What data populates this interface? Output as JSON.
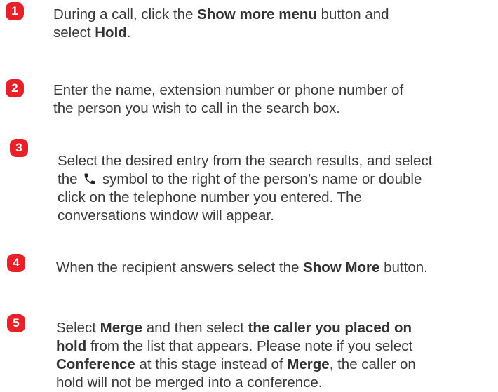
{
  "steps": [
    {
      "number": "1",
      "lines": [
        [
          {
            "t": "During a call, click the "
          },
          {
            "t": "Show more menu",
            "b": true
          },
          {
            "t": " button and"
          }
        ],
        [
          {
            "t": "select "
          },
          {
            "t": "Hold",
            "b": true
          },
          {
            "t": "."
          }
        ]
      ]
    },
    {
      "number": "2",
      "lines": [
        [
          {
            "t": "Enter the name, extension number or phone number of"
          }
        ],
        [
          {
            "t": "the person you wish to call in the search box."
          }
        ]
      ]
    },
    {
      "number": "3",
      "lines": [
        [
          {
            "t": "Select the desired entry from the search results, and select"
          }
        ],
        [
          {
            "t": "the "
          },
          {
            "icon": "phone-icon"
          },
          {
            "t": " symbol to the right of the person’s name or double"
          }
        ],
        [
          {
            "t": "click on the telephone number you entered. The"
          }
        ],
        [
          {
            "t": "conversations window will appear."
          }
        ]
      ]
    },
    {
      "number": "4",
      "lines": [
        [
          {
            "t": "When the recipient answers select the "
          },
          {
            "t": "Show More",
            "b": true
          },
          {
            "t": " button."
          }
        ]
      ]
    },
    {
      "number": "5",
      "lines": [
        [
          {
            "t": "Select "
          },
          {
            "t": "Merge",
            "b": true
          },
          {
            "t": " and then select "
          },
          {
            "t": "the caller you placed on",
            "b": true
          }
        ],
        [
          {
            "t": "hold",
            "b": true
          },
          {
            "t": " from the list that appears. Please note if you select"
          }
        ],
        [
          {
            "t": "Conference",
            "b": true
          },
          {
            "t": " at this stage instead of "
          },
          {
            "t": "Merge",
            "b": true
          },
          {
            "t": ", the caller on"
          }
        ],
        [
          {
            "t": "hold will not be merged into a conference."
          }
        ]
      ]
    }
  ],
  "colors": {
    "badge": "#e8202a",
    "text": "#3a3a3a"
  }
}
